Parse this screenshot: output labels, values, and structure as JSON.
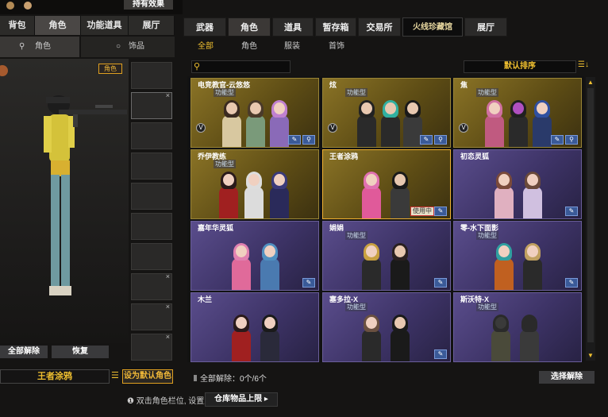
{
  "left_panel": {
    "effect_button": "持有效果",
    "tabs": [
      {
        "label": "背包"
      },
      {
        "label": "角色"
      },
      {
        "label": "功能道具"
      },
      {
        "label": "展厅"
      }
    ],
    "sub_tabs": [
      {
        "label": "角色"
      },
      {
        "label": "饰品"
      }
    ],
    "role_badge": "角色",
    "unequip_all": "全部解除",
    "restore": "恢复",
    "selected_name": "王者涂鸦",
    "set_default": "设为默认角色"
  },
  "right_panel": {
    "tabs": [
      {
        "label": "武器"
      },
      {
        "label": "角色"
      },
      {
        "label": "道具"
      },
      {
        "label": "暂存箱"
      },
      {
        "label": "交易所"
      },
      {
        "label": "火线珍藏馆"
      },
      {
        "label": "展厅"
      }
    ],
    "sub_tabs": [
      {
        "label": "全部"
      },
      {
        "label": "角色"
      },
      {
        "label": "服装"
      },
      {
        "label": "首饰"
      }
    ],
    "search_placeholder": "",
    "sort_label": "默认排序",
    "cards": [
      {
        "name": "电竞教官-云悠悠",
        "tag": "功能型",
        "style": "gold"
      },
      {
        "name": "炫",
        "tag": "功能型",
        "style": "gold"
      },
      {
        "name": "焦",
        "tag": "功能型",
        "style": "gold"
      },
      {
        "name": "乔伊教练",
        "tag": "功能型",
        "style": "gold"
      },
      {
        "name": "王者涂鸦",
        "tag": "",
        "style": "gold",
        "equipped": "使用中"
      },
      {
        "name": "初恋灵狐",
        "tag": "",
        "style": "purple"
      },
      {
        "name": "嘉年华灵狐",
        "tag": "",
        "style": "purple"
      },
      {
        "name": "娟娟",
        "tag": "功能型",
        "style": "purple"
      },
      {
        "name": "零-水下面影",
        "tag": "功能型",
        "style": "purple"
      },
      {
        "name": "木兰",
        "tag": "",
        "style": "purple"
      },
      {
        "name": "塞多拉-X",
        "tag": "功能型",
        "style": "purple"
      },
      {
        "name": "斯沃特-X",
        "tag": "功能型",
        "style": "purple"
      }
    ],
    "status_text": "全部解除：0个/6个",
    "select_unequip": "选择解除"
  },
  "bottom": {
    "tip": "双击角色栏位, 设置主",
    "warehouse_limit": "仓库物品上限"
  },
  "colors": {
    "gold_text": "#f0c030",
    "accent_blue": "#3a5a98"
  }
}
